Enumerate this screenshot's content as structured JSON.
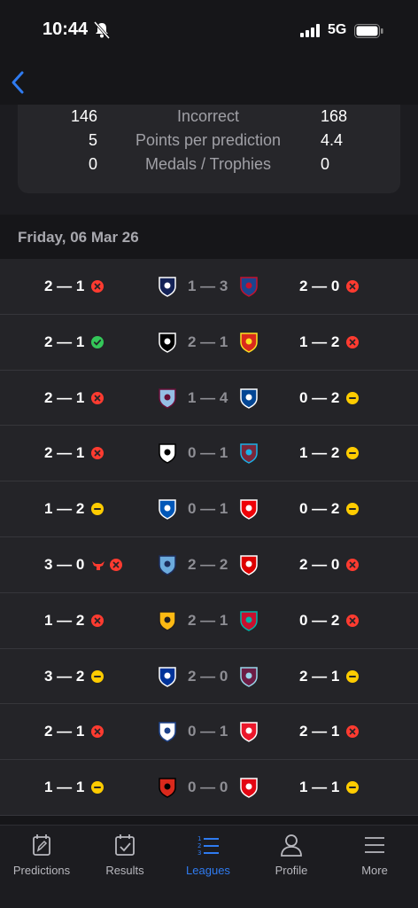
{
  "status_bar": {
    "time": "10:44",
    "network": "5G"
  },
  "stats": [
    {
      "left": "146",
      "label": "Incorrect",
      "right": "168"
    },
    {
      "left": "5",
      "label": "Points per prediction",
      "right": "4.4"
    },
    {
      "left": "0",
      "label": "Medals / Trophies",
      "right": "0"
    }
  ],
  "date_header": "Friday, 06 Mar 26",
  "matches": [
    {
      "pred_left": "2 — 1",
      "left_result": "incorrect",
      "actual": "1 — 3",
      "home": "tottenham-crest",
      "away": "crystal-palace-crest",
      "pred_right": "2 — 0",
      "right_result": "incorrect"
    },
    {
      "pred_left": "2 — 1",
      "left_result": "correct",
      "actual": "2 — 1",
      "home": "newcastle-crest",
      "away": "man-united-crest",
      "pred_right": "1 — 2",
      "right_result": "incorrect"
    },
    {
      "pred_left": "2 — 1",
      "left_result": "incorrect",
      "actual": "1 — 4",
      "home": "aston-villa-crest",
      "away": "chelsea-crest",
      "pred_right": "0 — 2",
      "right_result": "partial"
    },
    {
      "pred_left": "2 — 1",
      "left_result": "incorrect",
      "actual": "0 — 1",
      "home": "fulham-crest",
      "away": "west-ham-crest",
      "pred_right": "1 — 2",
      "right_result": "partial"
    },
    {
      "pred_left": "1 — 2",
      "left_result": "partial",
      "actual": "0 — 1",
      "home": "brighton-crest",
      "away": "arsenal-crest",
      "pred_right": "0 — 2",
      "right_result": "partial"
    },
    {
      "pred_left": "3 — 0",
      "left_result": "incorrect",
      "left_extra": "bull-icon",
      "actual": "2 — 2",
      "home": "man-city-crest",
      "away": "nottingham-forest-crest",
      "pred_right": "2 — 0",
      "right_result": "incorrect"
    },
    {
      "pred_left": "1 — 2",
      "left_result": "incorrect",
      "actual": "2 — 1",
      "home": "wolves-crest",
      "away": "liverpool-crest",
      "pred_right": "0 — 2",
      "right_result": "incorrect"
    },
    {
      "pred_left": "3 — 2",
      "left_result": "partial",
      "actual": "2 — 0",
      "home": "everton-crest",
      "away": "burnley-crest",
      "pred_right": "2 — 1",
      "right_result": "partial"
    },
    {
      "pred_left": "2 — 1",
      "left_result": "incorrect",
      "actual": "0 — 1",
      "home": "leeds-crest",
      "away": "sunderland-crest",
      "pred_right": "2 — 1",
      "right_result": "incorrect"
    },
    {
      "pred_left": "1 — 1",
      "left_result": "partial",
      "actual": "0 — 0",
      "home": "bournemouth-crest",
      "away": "brentford-crest",
      "pred_right": "1 — 1",
      "right_result": "partial"
    }
  ],
  "colors": {
    "correct": "#34c759",
    "incorrect": "#ff3b30",
    "partial": "#ffcc00",
    "accent": "#2f7bf0"
  },
  "tabs": [
    {
      "label": "Predictions",
      "icon": "edit-doc-icon"
    },
    {
      "label": "Results",
      "icon": "calendar-check-icon"
    },
    {
      "label": "Leagues",
      "icon": "ranked-list-icon",
      "active": true
    },
    {
      "label": "Profile",
      "icon": "person-icon"
    },
    {
      "label": "More",
      "icon": "menu-icon"
    }
  ]
}
